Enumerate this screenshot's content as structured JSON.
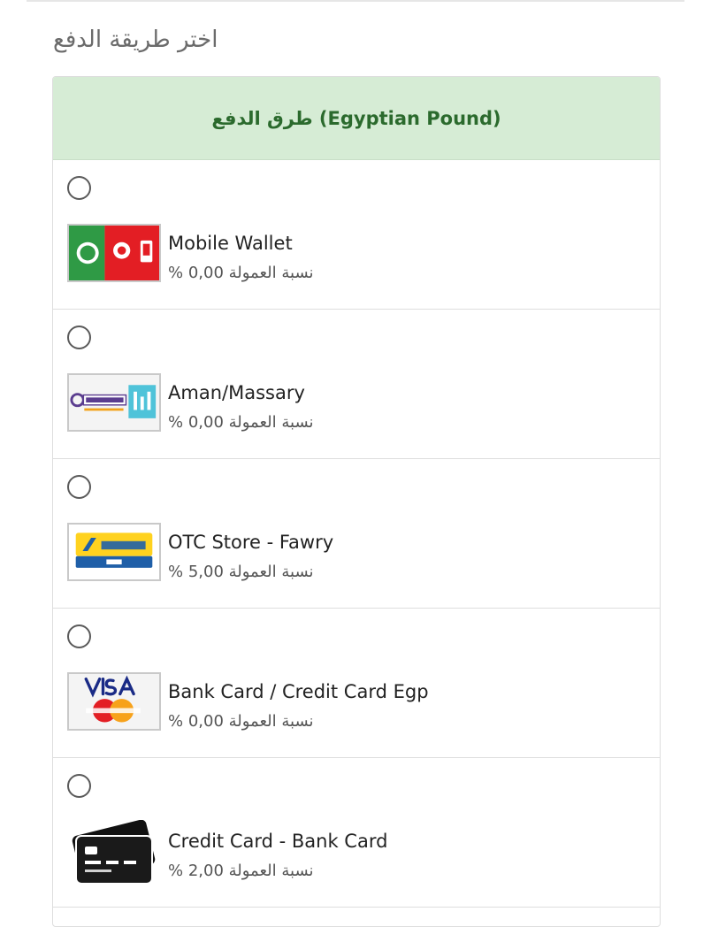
{
  "page": {
    "title": "اختر طريقة الدفع"
  },
  "panel": {
    "header": "طرق الدفع (Egyptian Pound)"
  },
  "methods": [
    {
      "name": "Mobile Wallet",
      "fee": "نسبة العمولة 0,00 %",
      "logo": "vodafone-cash-etisalat-logo"
    },
    {
      "name": "Aman/Massary",
      "fee": "نسبة العمولة 0,00 %",
      "logo": "aman-masary-logo"
    },
    {
      "name": "OTC Store - Fawry",
      "fee": "نسبة العمولة 5,00 %",
      "logo": "fawry-pay-logo"
    },
    {
      "name": "Bank Card / Credit Card Egp",
      "fee": "نسبة العمولة 0,00 %",
      "logo": "visa-mastercard-logo"
    },
    {
      "name": "Credit Card - Bank Card",
      "fee": "نسبة العمولة 2,00 %",
      "logo": "credit-card-icon"
    }
  ],
  "colors": {
    "header_bg": "#d6ecd5",
    "header_text": "#2b6a2d"
  }
}
